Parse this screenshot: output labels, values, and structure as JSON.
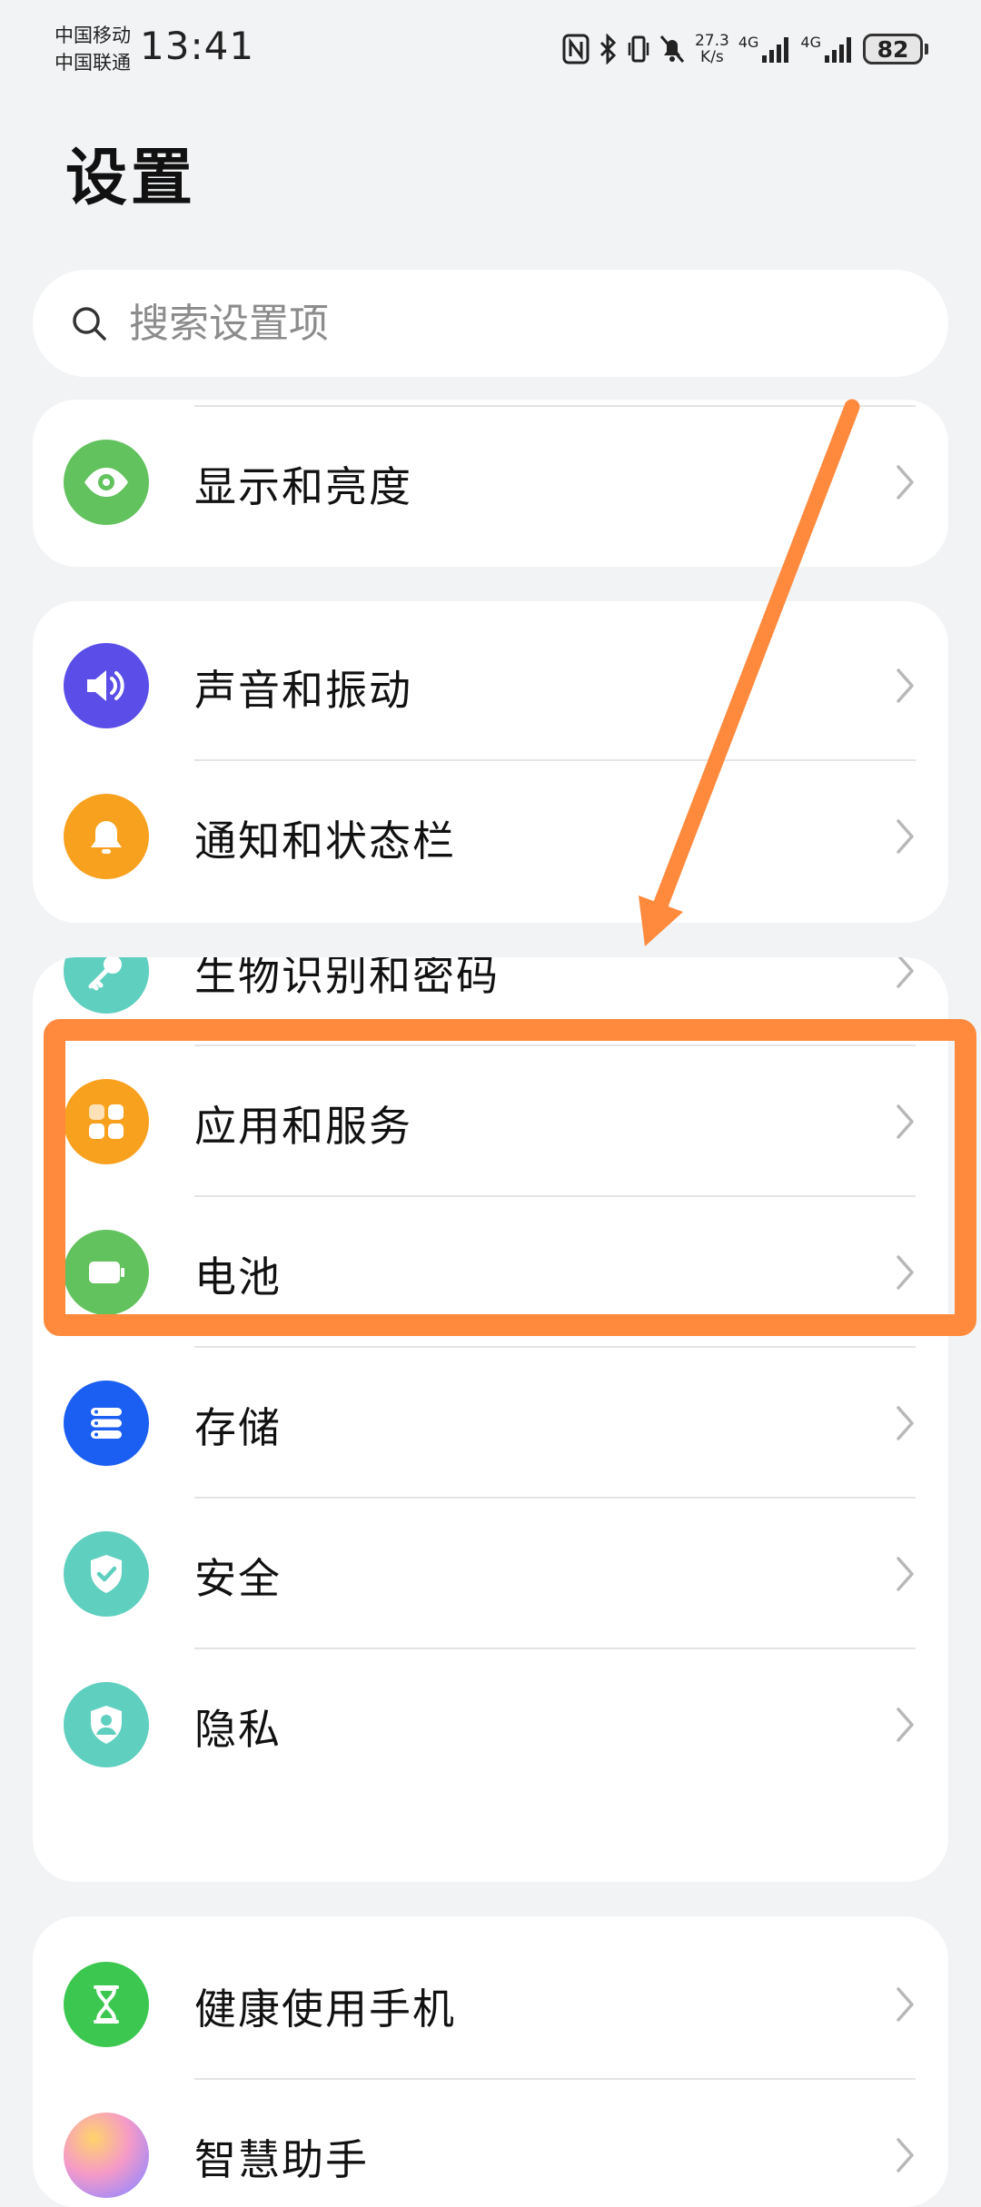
{
  "status_bar": {
    "carrier_1": "中国移动",
    "carrier_2": "中国联通",
    "time": "13:41",
    "net_speed_value": "27.3",
    "net_speed_unit": "K/s",
    "network_1": "4G",
    "network_2": "4G",
    "battery": "82",
    "icons": [
      "nfc-icon",
      "bluetooth-icon",
      "vibrate-icon",
      "mute-icon",
      "signal-icon",
      "signal-icon"
    ]
  },
  "page": {
    "title": "设置"
  },
  "search": {
    "placeholder": "搜索设置项",
    "icon": "search-icon"
  },
  "groups": [
    {
      "items": [
        {
          "label": "显示和亮度",
          "icon": "eye-icon",
          "color": "#62c25e"
        }
      ]
    },
    {
      "items": [
        {
          "label": "声音和振动",
          "icon": "speaker-icon",
          "color": "#5a4de8"
        },
        {
          "label": "通知和状态栏",
          "icon": "bell-icon",
          "color": "#f8a11f"
        }
      ]
    },
    {
      "items": [
        {
          "label": "生物识别和密码",
          "icon": "key-icon",
          "color": "#5fcfbf"
        },
        {
          "label": "应用和服务",
          "icon": "apps-grid-icon",
          "color": "#f8a11f"
        },
        {
          "label": "电池",
          "icon": "battery-icon",
          "color": "#62c25e"
        },
        {
          "label": "存储",
          "icon": "storage-icon",
          "color": "#1b5ef2"
        },
        {
          "label": "安全",
          "icon": "shield-check-icon",
          "color": "#5fcfbf"
        },
        {
          "label": "隐私",
          "icon": "privacy-shield-icon",
          "color": "#5fcfbf"
        }
      ]
    },
    {
      "items": [
        {
          "label": "健康使用手机",
          "icon": "hourglass-icon",
          "color": "#3cc850"
        },
        {
          "label": "智慧助手",
          "icon": "assistant-orb-icon",
          "color": "#f29ac8"
        }
      ]
    }
  ],
  "annotation": {
    "color": "#ff8a3d",
    "highlighted_item": "应用和服务"
  }
}
